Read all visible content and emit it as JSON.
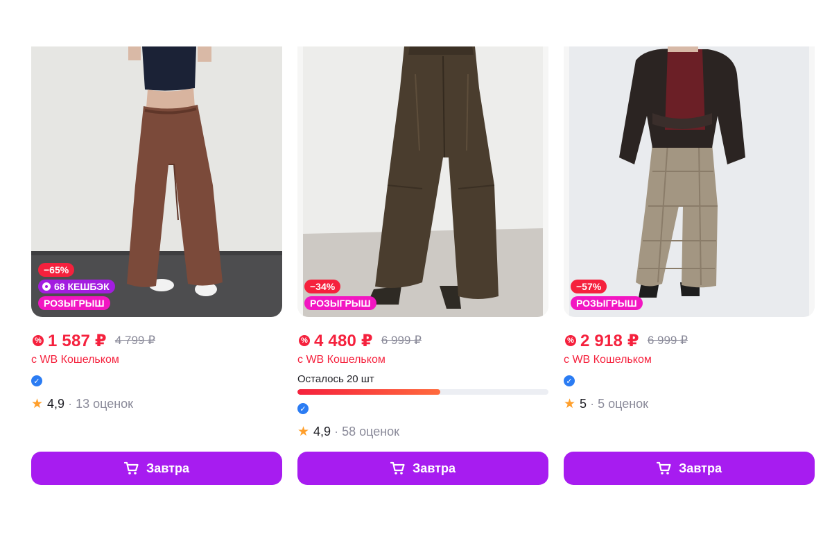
{
  "products": [
    {
      "discount": "−65%",
      "cashback": "68 КЕШБЭК",
      "raffle": "РОЗЫГРЫШ",
      "price": "1 587 ₽",
      "old_price": "4 799 ₽",
      "wallet_label": "с WB Кошельком",
      "rating": "4,9",
      "separator": "·",
      "reviews": "13 оценок",
      "button_label": "Завтра"
    },
    {
      "discount": "−34%",
      "raffle": "РОЗЫГРЫШ",
      "price": "4 480 ₽",
      "old_price": "6 999 ₽",
      "wallet_label": "с WB Кошельком",
      "stock_label": "Осталось 20 шт",
      "rating": "4,9",
      "separator": "·",
      "reviews": "58 оценок",
      "button_label": "Завтра"
    },
    {
      "discount": "−57%",
      "raffle": "РОЗЫГРЫШ",
      "price": "2 918 ₽",
      "old_price": "6 999 ₽",
      "wallet_label": "с WB Кошельком",
      "rating": "5",
      "separator": "·",
      "reviews": "5 оценок",
      "button_label": "Завтра"
    }
  ],
  "icons": {
    "wallet": "wallet-discount-icon",
    "verified": "verified-check-icon",
    "star": "star-icon",
    "cart": "cart-icon"
  },
  "colors": {
    "accent": "#a71cf0",
    "price": "#f5213d",
    "discount_badge": "#f5213d",
    "cashback_badge": "#a31de0",
    "raffle_badge": "#f216c2",
    "verified": "#2b7cf3",
    "star": "#ff9f2b"
  },
  "stock_level": 0.57
}
